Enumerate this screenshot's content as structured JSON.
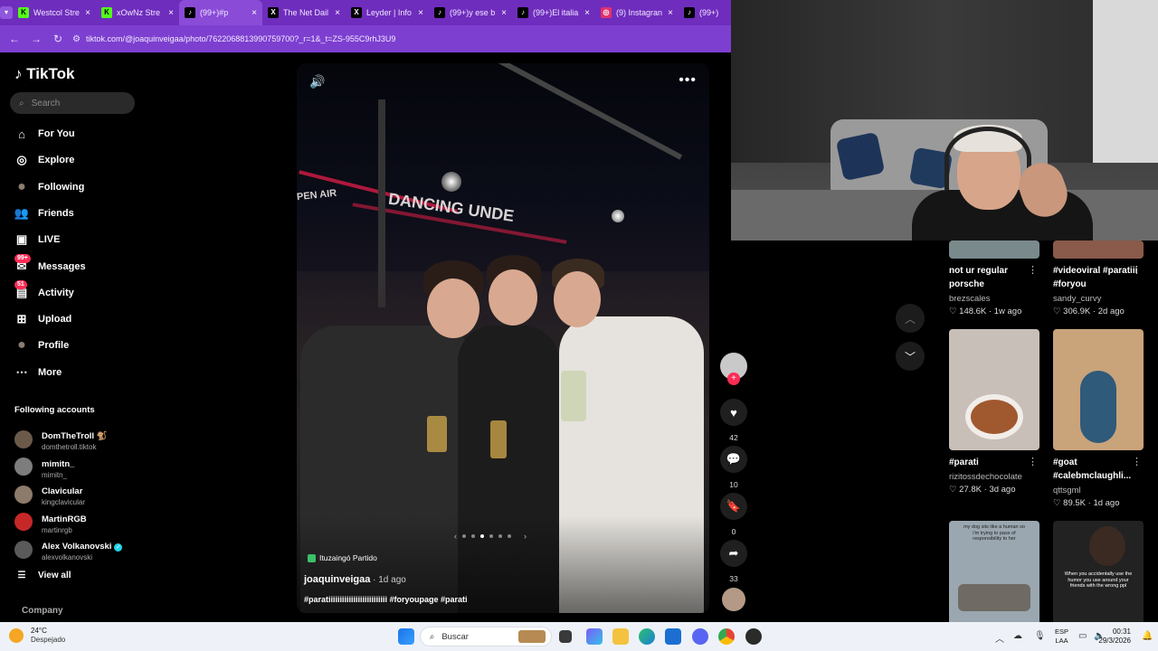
{
  "browser": {
    "tabs": [
      {
        "label": "Westcol Stre",
        "icon": "kick-icon",
        "color": "#53fc18"
      },
      {
        "label": "xOwNz Stre",
        "icon": "kick-icon",
        "color": "#53fc18"
      },
      {
        "label": "(99+)#p",
        "icon": "tiktok-icon",
        "color": "#000000",
        "active": true
      },
      {
        "label": "The Net Dail",
        "icon": "x-icon",
        "color": "#000000"
      },
      {
        "label": "Leyder | Info",
        "icon": "x-icon",
        "color": "#000000"
      },
      {
        "label": "(99+)y ese b",
        "icon": "tiktok-icon",
        "color": "#000000"
      },
      {
        "label": "(99+)El italia",
        "icon": "tiktok-icon",
        "color": "#000000"
      },
      {
        "label": "(9) Instagran",
        "icon": "instagram-icon",
        "color": "#e1306c"
      },
      {
        "label": "(99+)",
        "icon": "tiktok-icon",
        "color": "#000000"
      }
    ],
    "url": "tiktok.com/@joaquinveigaa/photo/7622068813990759700?_r=1&_t=ZS-955C9rhJ3U9"
  },
  "sidebar": {
    "logo": "TikTok",
    "search_placeholder": "Search",
    "nav": [
      {
        "label": "For You",
        "icon": "home-icon"
      },
      {
        "label": "Explore",
        "icon": "compass-icon"
      },
      {
        "label": "Following",
        "icon": "following-avatar-icon"
      },
      {
        "label": "Friends",
        "icon": "friends-icon"
      },
      {
        "label": "LIVE",
        "icon": "live-icon"
      },
      {
        "label": "Messages",
        "icon": "messages-icon",
        "badge": "99+"
      },
      {
        "label": "Activity",
        "icon": "activity-icon",
        "badge": "51"
      },
      {
        "label": "Upload",
        "icon": "upload-icon"
      },
      {
        "label": "Profile",
        "icon": "profile-avatar-icon"
      },
      {
        "label": "More",
        "icon": "more-dots-icon"
      }
    ],
    "following_title": "Following accounts",
    "accounts": [
      {
        "name": "DomTheTroll 🐒",
        "handle": "domthetroll.tiktok"
      },
      {
        "name": "mimitn_",
        "handle": "mimitn_"
      },
      {
        "name": "Clavicular",
        "handle": "kingclavicular"
      },
      {
        "name": "MartinRGB",
        "handle": "martinrgb"
      },
      {
        "name": "Alex Volkanovski",
        "handle": "alexvolkanovski",
        "verified": true
      }
    ],
    "view_all": "View all",
    "company": "Company"
  },
  "post": {
    "sign_text": "DANCING UNDE",
    "sign_text_2": "PEN AIR",
    "location": "Ituzaingó Partido",
    "author": "joaquinveigaa",
    "ago": " · 1d ago",
    "caption": "#paratiiiiiiiiiiiiiiiiiiiiiiiiii #foryoupage #parati",
    "likes": "42",
    "comments": "10",
    "saves": "0",
    "shares": "33"
  },
  "recommended": [
    {
      "title": "not ur regular porsche",
      "user": "brezscales",
      "likes": "148.6K",
      "ago": "1w ago",
      "color": "#7a8a8c"
    },
    {
      "title": "#videoviral #paratiii #foryou",
      "user": "sandy_curvy",
      "likes": "306.9K",
      "ago": "2d ago",
      "color": "#8a5a4a"
    },
    {
      "title": "#parati",
      "user": "rizitossdechocolate",
      "likes": "27.8K",
      "ago": "3d ago",
      "color": "#c7bfb8"
    },
    {
      "title": "#goat #calebmclaughli...",
      "user": "qttsgml",
      "likes": "89.5K",
      "ago": "1d ago",
      "color": "#c9a37a"
    },
    {
      "title": "my dog sits like a human so i'm trying to pass of responsibility to her",
      "color": "#9aa7b0"
    },
    {
      "title": "When you accidentally use the humor you use around your friends with the wrong ppl",
      "color": "#222222"
    }
  ],
  "taskbar": {
    "temp": "24°C",
    "weather": "Despejado",
    "search": "Buscar",
    "lang1": "ESP",
    "lang2": "LAA",
    "time": "00:31",
    "date": "29/3/2026"
  }
}
